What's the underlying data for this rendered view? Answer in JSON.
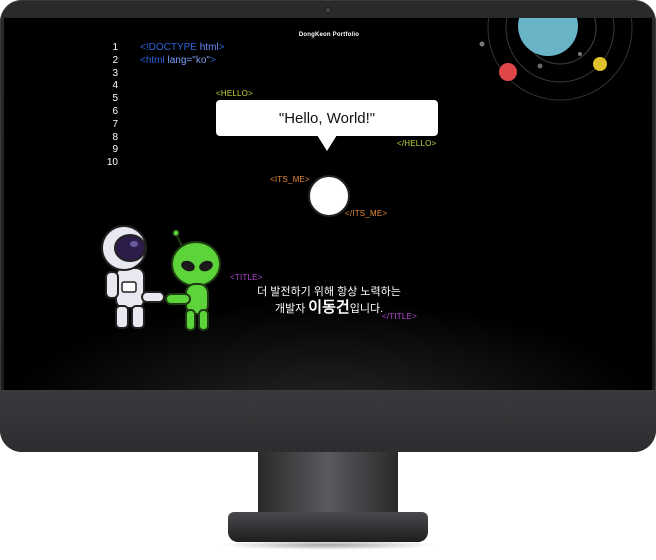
{
  "site": {
    "title": "DongKeon Portfolio"
  },
  "code": {
    "line_numbers": [
      "1",
      "2",
      "3",
      "4",
      "5",
      "6",
      "7",
      "8",
      "9",
      "10"
    ],
    "line1": {
      "open": "<!DOCTYPE ",
      "kw": "html",
      "close": ">"
    },
    "line2": {
      "open": "<html ",
      "attr": "lang=",
      "str": "\"ko\"",
      "close": ">"
    }
  },
  "hello": {
    "open_tag": "<HELLO>",
    "message": "\"Hello, World!\"",
    "close_tag": "</HELLO>"
  },
  "its_me": {
    "open_tag": "<ITS_ME>",
    "close_tag": "</ITS_ME>"
  },
  "title": {
    "open_tag": "<TITLE>",
    "line1": "더 발전하기 위해 항상 노력하는",
    "line2_prefix": "개발자 ",
    "name": "이동건",
    "line2_suffix": "입니다.",
    "close_tag": "</TITLE>"
  },
  "colors": {
    "screen": "#000000",
    "hello_tag": "#c6d43a",
    "its_me_tag": "#e58a3a",
    "title_tag": "#b04ad4",
    "code_blue": "#2a63d6",
    "planet_teal": "#6ab4c8",
    "planet_red": "#e04848",
    "planet_yellow": "#e2c02a",
    "alien_green": "#5cd43a"
  },
  "icons": {
    "camera": "camera-dot-icon",
    "astronaut": "astronaut-illustration",
    "alien": "alien-illustration",
    "solar_system": "solar-system-illustration"
  }
}
